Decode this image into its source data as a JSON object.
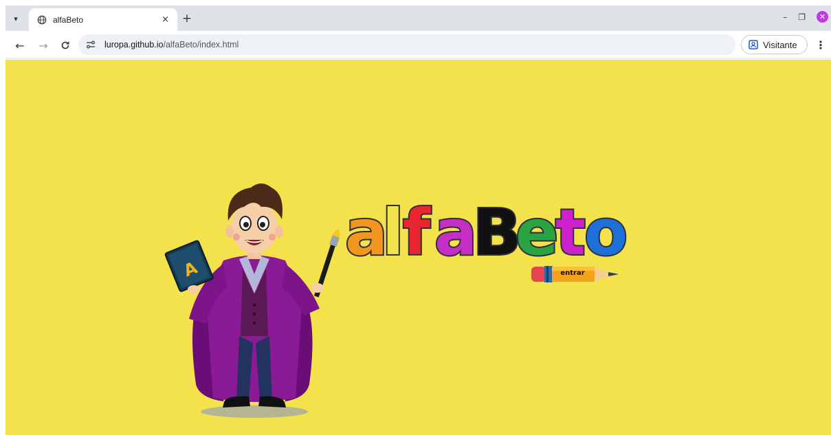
{
  "browser": {
    "tab": {
      "title": "alfaBeto",
      "close": "×"
    },
    "new_tab": "+",
    "window_controls": {
      "minimize": "–",
      "restore": "❐",
      "close": "✕"
    },
    "url": {
      "host": "luropa.github.io",
      "path": "/alfaBeto/index.html"
    },
    "profile": {
      "label": "Visitante"
    },
    "icons": [
      "tab-search-icon",
      "globe-icon",
      "back-arrow-icon",
      "forward-arrow-icon",
      "reload-icon",
      "site-info-icon",
      "profile-icon",
      "kebab-menu-icon"
    ]
  },
  "page": {
    "background": "#f4e24c",
    "logo": {
      "letters": [
        {
          "char": "a",
          "color": "#f2961e"
        },
        {
          "char": "l",
          "color": "#f4e24c"
        },
        {
          "char": "f",
          "color": "#e8262d"
        },
        {
          "char": "a",
          "color": "#c42ec4"
        },
        {
          "char": "B",
          "color": "#111111"
        },
        {
          "char": "e",
          "color": "#2aa443"
        },
        {
          "char": "t",
          "color": "#cc22cc"
        },
        {
          "char": "o",
          "color": "#1e6fd8"
        }
      ]
    },
    "enter_button": {
      "label": "entrar"
    }
  }
}
